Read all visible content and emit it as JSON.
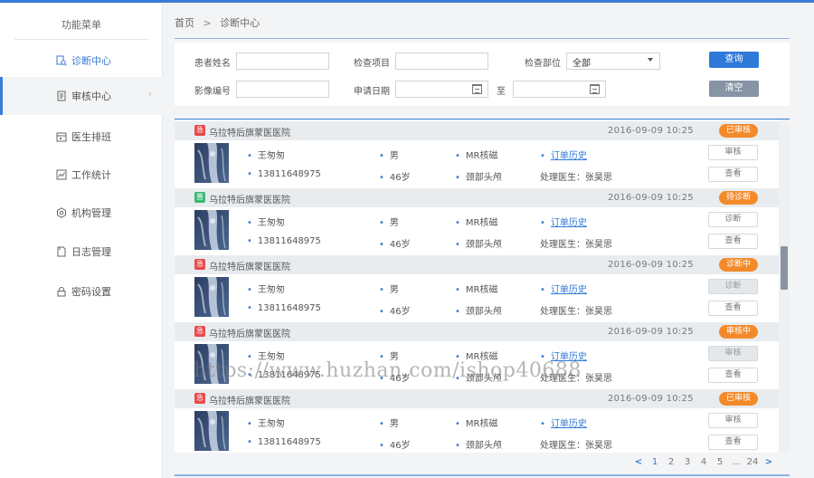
{
  "sidebar": {
    "title": "功能菜单",
    "items": [
      {
        "label": "诊断中心",
        "icon": "search-doc-icon"
      },
      {
        "label": "审核中心",
        "icon": "doc-icon"
      },
      {
        "label": "医生排班",
        "icon": "calendar-icon"
      },
      {
        "label": "工作统计",
        "icon": "chart-icon"
      },
      {
        "label": "机构管理",
        "icon": "gear-icon"
      },
      {
        "label": "日志管理",
        "icon": "file-icon"
      },
      {
        "label": "密码设置",
        "icon": "lock-icon"
      }
    ]
  },
  "breadcrumb": {
    "home": "首页",
    "separator": ">",
    "current": "诊断中心"
  },
  "search": {
    "patient_name_label": "患者姓名",
    "patient_name_value": "",
    "exam_item_label": "检查项目",
    "exam_item_value": "",
    "exam_part_label": "检查部位",
    "exam_part_value": "全部",
    "image_no_label": "影像编号",
    "image_no_value": "",
    "apply_date_label": "申请日期",
    "date_to": "至",
    "query_button": "查询",
    "clear_button": "清空"
  },
  "records": [
    {
      "tag": "急",
      "tag_color": "#e84a4a",
      "hospital": "乌拉特后旗蒙医医院",
      "time": "2016-09-09  10:25",
      "status": "已审核",
      "name": "王匆匆",
      "gender": "男",
      "modality": "MR核磁",
      "history": "订单历史",
      "phone": "13811648975",
      "age": "46岁",
      "part": "颈部头颅",
      "doctor": "处理医生：张昊思",
      "btn1": "审核",
      "btn1_disabled": false,
      "btn2": "查看"
    },
    {
      "tag": "普",
      "tag_color": "#3cb878",
      "hospital": "乌拉特后旗蒙医医院",
      "time": "2016-09-09  10:25",
      "status": "待诊断",
      "name": "王匆匆",
      "gender": "男",
      "modality": "MR核磁",
      "history": "订单历史",
      "phone": "13811648975",
      "age": "46岁",
      "part": "颈部头颅",
      "doctor": "处理医生：张昊思",
      "btn1": "诊断",
      "btn1_disabled": false,
      "btn2": "查看"
    },
    {
      "tag": "急",
      "tag_color": "#e84a4a",
      "hospital": "乌拉特后旗蒙医医院",
      "time": "2016-09-09  10:25",
      "status": "诊断中",
      "name": "王匆匆",
      "gender": "男",
      "modality": "MR核磁",
      "history": "订单历史",
      "phone": "13811648975",
      "age": "46岁",
      "part": "颈部头颅",
      "doctor": "处理医生：张昊思",
      "btn1": "诊断",
      "btn1_disabled": true,
      "btn2": "查看"
    },
    {
      "tag": "急",
      "tag_color": "#e84a4a",
      "hospital": "乌拉特后旗蒙医医院",
      "time": "2016-09-09  10:25",
      "status": "审核中",
      "name": "王匆匆",
      "gender": "男",
      "modality": "MR核磁",
      "history": "订单历史",
      "phone": "13811648975",
      "age": "46岁",
      "part": "颈部头颅",
      "doctor": "处理医生：张昊思",
      "btn1": "审核",
      "btn1_disabled": true,
      "btn2": "查看"
    },
    {
      "tag": "急",
      "tag_color": "#e84a4a",
      "hospital": "乌拉特后旗蒙医医院",
      "time": "2016-09-09  10:25",
      "status": "已审核",
      "name": "王匆匆",
      "gender": "男",
      "modality": "MR核磁",
      "history": "订单历史",
      "phone": "13811648975",
      "age": "46岁",
      "part": "颈部头颅",
      "doctor": "处理医生：张昊思",
      "btn1": "审核",
      "btn1_disabled": false,
      "btn2": "查看"
    }
  ],
  "pagination": {
    "prev": "<",
    "pages": [
      "1",
      "2",
      "3",
      "4",
      "5",
      "...",
      "24"
    ],
    "current": "1",
    "next": ">"
  },
  "watermark": "https://www.huzhan.com/ishop40688",
  "colors": {
    "accent": "#3a7bd5",
    "status_orange": "#f38a2a",
    "urgent_red": "#e84a4a",
    "normal_green": "#3cb878"
  }
}
